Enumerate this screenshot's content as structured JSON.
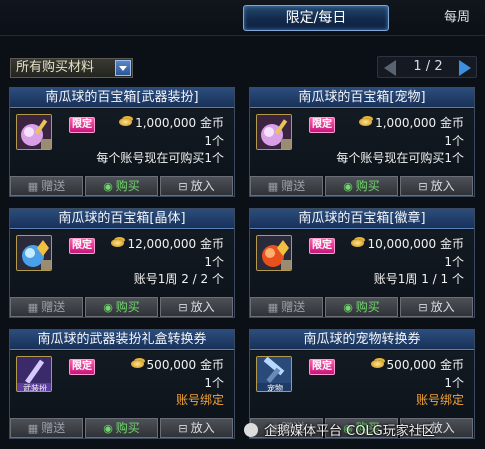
{
  "tabs": {
    "active": "限定/每日",
    "other": "每周"
  },
  "filter": {
    "selected": "所有购买材料"
  },
  "pager": {
    "text": "1 / 2"
  },
  "buttons": {
    "gift": "赠送",
    "buy": "购买",
    "put": "放入"
  },
  "items": [
    {
      "title": "南瓜球的百宝箱[武器装扮]",
      "badge": "限定",
      "price": "1,000,000 金币",
      "qty": "1个",
      "note": "每个账号现在可购买1个",
      "icon": "pumpkin-box-weapon-icon"
    },
    {
      "title": "南瓜球的百宝箱[宠物]",
      "badge": "限定",
      "price": "1,000,000 金币",
      "qty": "1个",
      "note": "每个账号现在可购买1个",
      "icon": "pumpkin-box-pet-icon"
    },
    {
      "title": "南瓜球的百宝箱[晶体]",
      "badge": "限定",
      "price": "12,000,000 金币",
      "qty": "1个",
      "note": "账号1周 2 / 2 个",
      "icon": "pumpkin-box-crystal-icon"
    },
    {
      "title": "南瓜球的百宝箱[徽章]",
      "badge": "限定",
      "price": "10,000,000 金币",
      "qty": "1个",
      "note": "账号1周 1 / 1 个",
      "icon": "pumpkin-box-emblem-icon"
    },
    {
      "title": "南瓜球的武器装扮礼盒转换券",
      "badge": "限定",
      "price": "500,000 金币",
      "qty": "1个",
      "note": "账号绑定",
      "icon": "weapon-voucher-icon",
      "icon_label": "武装扮"
    },
    {
      "title": "南瓜球的宠物转换券",
      "badge": "限定",
      "price": "500,000 金币",
      "qty": "1个",
      "note": "账号绑定",
      "icon": "pet-voucher-icon",
      "icon_label": "宠物"
    }
  ],
  "watermark": "企鹅媒体平台 COLG玩家社区"
}
